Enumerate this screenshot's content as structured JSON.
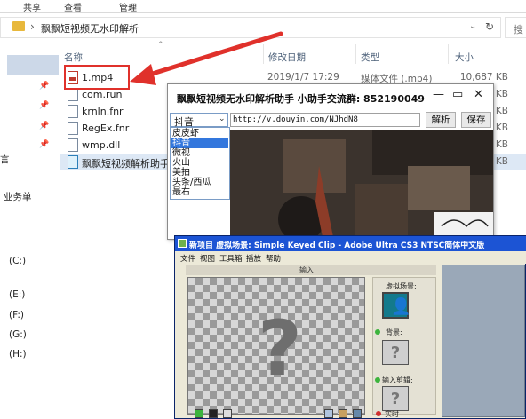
{
  "ribbon": {
    "tabs": [
      "共享",
      "查看",
      "管理"
    ]
  },
  "address": {
    "path": "飘飘短视频无水印解析",
    "search_placeholder": "搜"
  },
  "columns": {
    "name": "名称",
    "modified": "修改日期",
    "type": "类型",
    "size": "大小"
  },
  "nav": {
    "items": [
      "言",
      "业务单",
      "(C:)",
      "(E:)",
      "(F:)",
      "(G:)",
      "(H:)"
    ]
  },
  "files": [
    {
      "name": "1.mp4",
      "date": "2019/1/7 17:29",
      "type": "媒体文件 (.mp4)",
      "size": "10,687 KB"
    },
    {
      "name": "com.run",
      "size": "KB"
    },
    {
      "name": "krnln.fnr",
      "size": "KB"
    },
    {
      "name": "RegEx.fnr",
      "size": "KB"
    },
    {
      "name": "wmp.dll",
      "size": "KB"
    },
    {
      "name": "飘飘短视频解析助手",
      "size": "KB"
    }
  ],
  "parser_window": {
    "title": "飘飘短视频无水印解析助手  小助手交流群:  852190049",
    "platform_selected": "抖音",
    "url": "http://v.douyin.com/NJhdN8",
    "parse_button": "解析",
    "save_button": "保存",
    "platform_options": [
      "皮皮虾",
      "抖音",
      "微视",
      "火山",
      "美拍",
      "头条/西瓜",
      "最右"
    ],
    "selected_option_index": 1
  },
  "ultra_window": {
    "title": "新项目    虚拟场景: Simple Keyed Clip  -  Adobe Ultra CS3 NTSC简体中文版",
    "menu": [
      "文件",
      "视图",
      "工具箱",
      "播放",
      "帮助"
    ],
    "input_tab": "输入",
    "virtual_scene_label": "虚拟场景:",
    "background_label": "背景:",
    "input_clip_label": "输入剪辑:",
    "realtime_label": "实时"
  },
  "colors": {
    "highlight": "#e0312b",
    "xp_title": "#1c54d4",
    "selection": "#3377dd"
  }
}
